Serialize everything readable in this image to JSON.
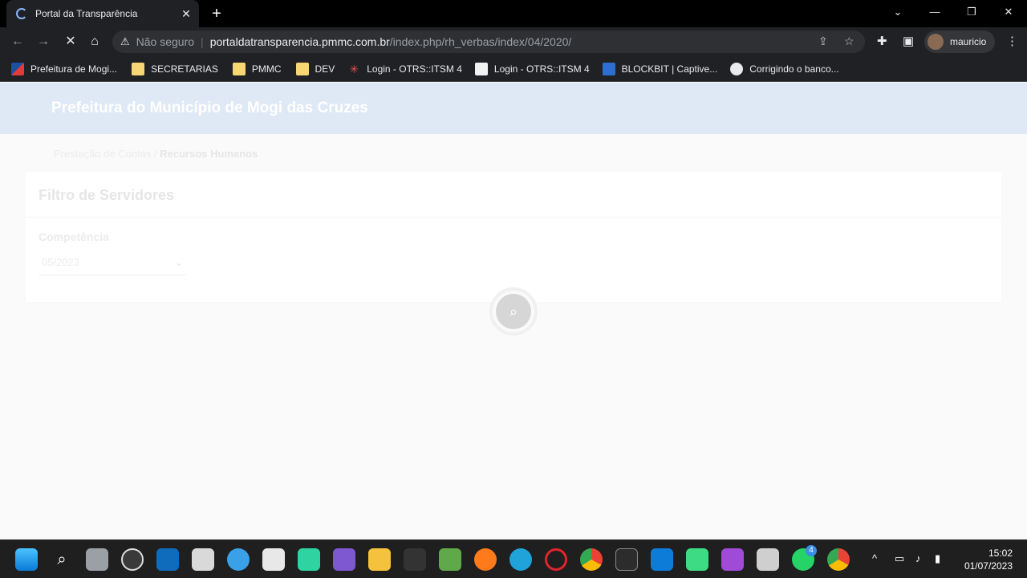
{
  "browser": {
    "tab_title": "Portal da Transparência",
    "close_glyph": "✕",
    "new_tab_glyph": "+",
    "security_label": "Não seguro",
    "url_host": "portaldatransparencia.pmmc.com.br",
    "url_path": "/index.php/rh_verbas/index/04/2020/",
    "profile_name": "mauricio"
  },
  "bookmarks": [
    {
      "label": "Prefeitura de Mogi...",
      "icon": "flag-icon"
    },
    {
      "label": "SECRETARIAS",
      "icon": "folder-icon"
    },
    {
      "label": "PMMC",
      "icon": "folder-icon"
    },
    {
      "label": "DEV",
      "icon": "folder-icon"
    },
    {
      "label": "Login - OTRS::ITSM 4",
      "icon": "otrs-icon"
    },
    {
      "label": "Login - OTRS::ITSM 4",
      "icon": "dse-icon"
    },
    {
      "label": "BLOCKBIT | Captive...",
      "icon": "blockbit-icon"
    },
    {
      "label": "Corrigindo o banco...",
      "icon": "globe-icon"
    }
  ],
  "page": {
    "banner_title": "Prefeitura do Município de Mogi das Cruzes",
    "breadcrumb_parent": "Prestação de Contas",
    "breadcrumb_sep": " / ",
    "breadcrumb_current": "Recursos Humanos",
    "filter_title": "Filtro de Servidores",
    "competencia_label": "Competência",
    "competencia_value": "05/2023"
  },
  "taskbar": {
    "time": "15:02",
    "date": "01/07/2023",
    "whatsapp_badge": "4"
  },
  "colors": {
    "banner": "#dfe8f5",
    "chrome_bg": "#202124",
    "taskbar_bg": "#1f1f1f"
  }
}
